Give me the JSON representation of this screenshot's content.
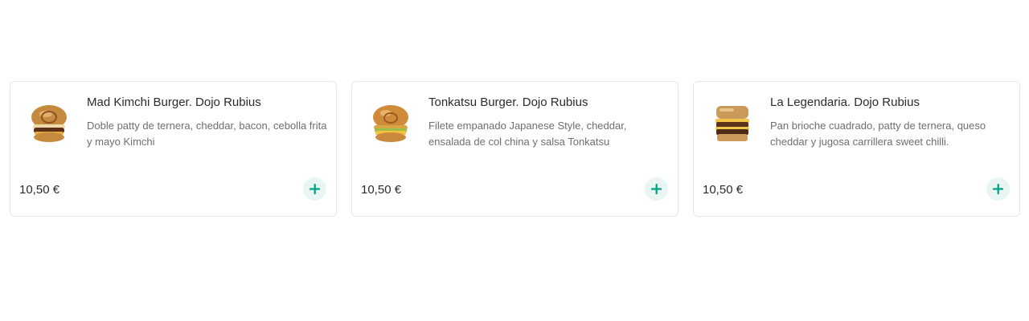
{
  "colors": {
    "accent": "#00a082",
    "add_button_bg": "#e9f5f2",
    "card_border": "#e6e6e6",
    "title_text": "#2b2b2b",
    "description_text": "#6e6e6e"
  },
  "products": [
    {
      "image": "burger-photo-icon",
      "title": "Mad Kimchi Burger. Dojo Rubius",
      "description": "Doble patty de ternera, cheddar, bacon, cebolla frita y mayo Kimchi",
      "price": "10,50 €",
      "add_icon": "plus-icon"
    },
    {
      "image": "burger-photo-icon",
      "title": "Tonkatsu Burger. Dojo Rubius",
      "description": "Filete empanado Japanese Style, cheddar, ensalada de col china y salsa Tonkatsu",
      "price": "10,50 €",
      "add_icon": "plus-icon"
    },
    {
      "image": "burger-photo-icon",
      "title": "La Legendaria. Dojo Rubius",
      "description": "Pan brioche cuadrado, patty de ternera, queso cheddar y jugosa carrillera sweet chilli.",
      "price": "10,50 €",
      "add_icon": "plus-icon"
    }
  ]
}
